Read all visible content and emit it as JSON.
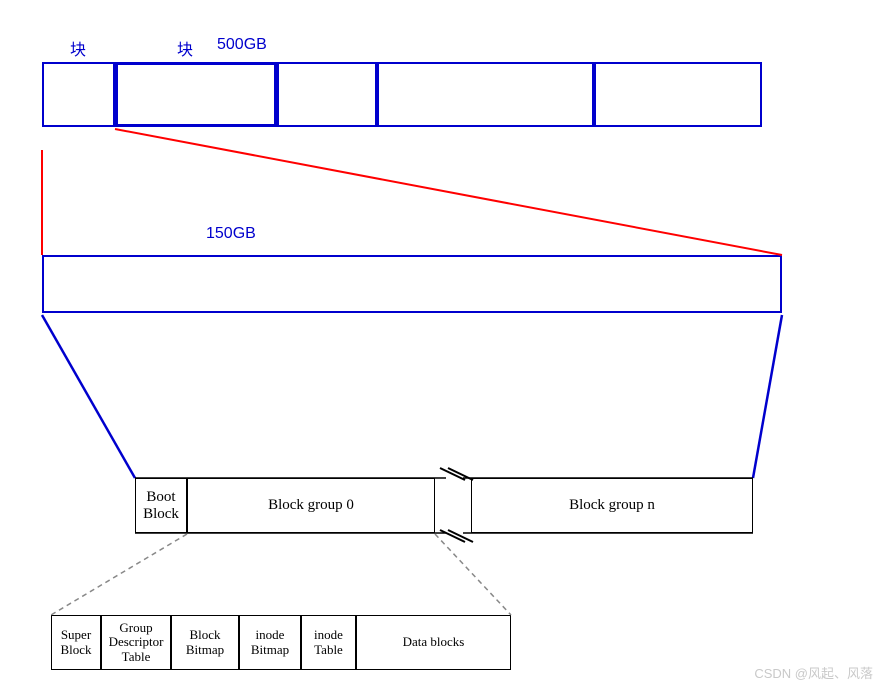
{
  "labels": {
    "kuai1": "块",
    "kuai2": "块",
    "size_top": "500GB",
    "size_mid": "150GB"
  },
  "block_groups": {
    "boot": "Boot\nBlock",
    "g0": "Block group 0",
    "gn": "Block group n"
  },
  "detail": {
    "super": "Super\nBlock",
    "gdt": "Group\nDescriptor\nTable",
    "bbmp": "Block\nBitmap",
    "ibmp": "inode\nBitmap",
    "itbl": "inode\nTable",
    "dblk": "Data blocks"
  },
  "watermark": "CSDN @风起、风落"
}
